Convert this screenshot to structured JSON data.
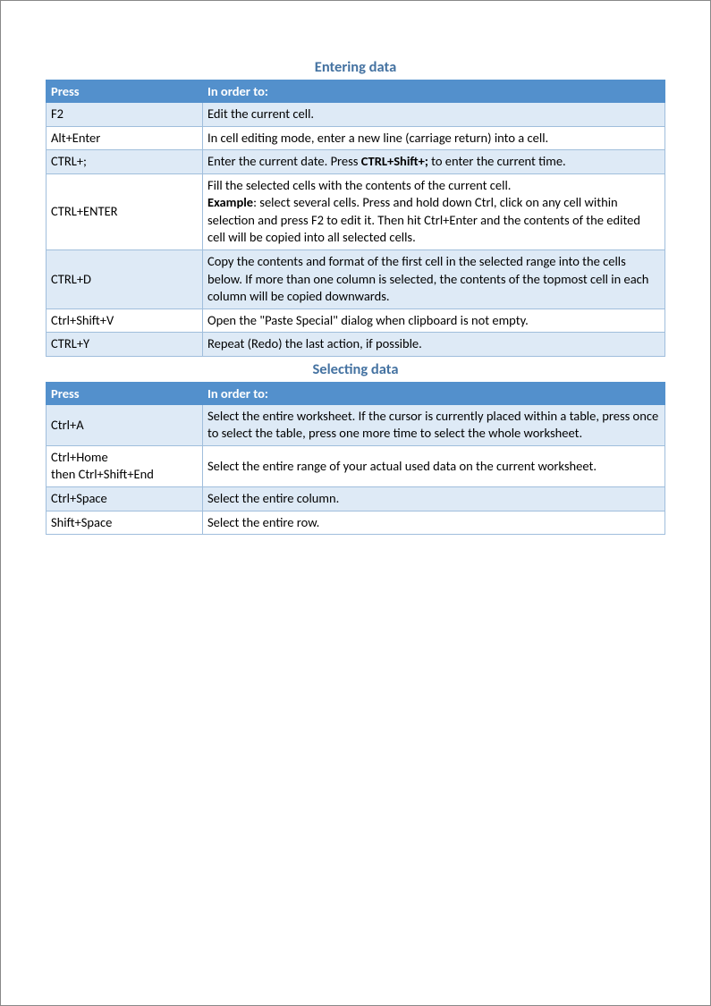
{
  "sections": [
    {
      "title": "Entering data",
      "header": {
        "col1": "Press",
        "col2": "In order to:"
      },
      "rows": [
        {
          "key": "F2",
          "desc": "Edit the current cell."
        },
        {
          "key": "Alt+Enter",
          "desc": "In cell editing mode, enter a new line (carriage return) into a cell."
        },
        {
          "key": "CTRL+;",
          "desc_html": "Enter the current date. Press <b>CTRL+Shift+;</b> to enter the current time."
        },
        {
          "key": "CTRL+ENTER",
          "desc_html": "Fill the selected cells with the contents of the current cell.<br><b>Example</b>: select several cells. Press and hold down Ctrl, click on any cell within selection and press F2 to edit it. Then hit Ctrl+Enter and the contents of the edited cell will be copied into all selected cells."
        },
        {
          "key": "CTRL+D",
          "desc": "Copy the contents and format of the first cell in the selected range into the cells below. If more than one column is selected, the contents of the topmost cell in each column will be copied downwards."
        },
        {
          "key": "Ctrl+Shift+V",
          "desc": "Open the \"Paste Special\" dialog when clipboard is not empty."
        },
        {
          "key": "CTRL+Y",
          "desc": "Repeat (Redo) the last action, if possible."
        }
      ]
    },
    {
      "title": "Selecting data",
      "header": {
        "col1": "Press",
        "col2": "In order to:"
      },
      "rows": [
        {
          "key": "Ctrl+A",
          "desc": "Select the entire worksheet.  If the cursor is currently placed within a table, press once to select the table, press one more time to select the whole worksheet."
        },
        {
          "key_html": "Ctrl+Home<br>then Ctrl+Shift+End",
          "desc": "Select the entire range of your actual used data on the current worksheet."
        },
        {
          "key": "Ctrl+Space",
          "desc": "Select the entire column."
        },
        {
          "key": "Shift+Space",
          "desc": "Select the entire row."
        }
      ]
    }
  ]
}
